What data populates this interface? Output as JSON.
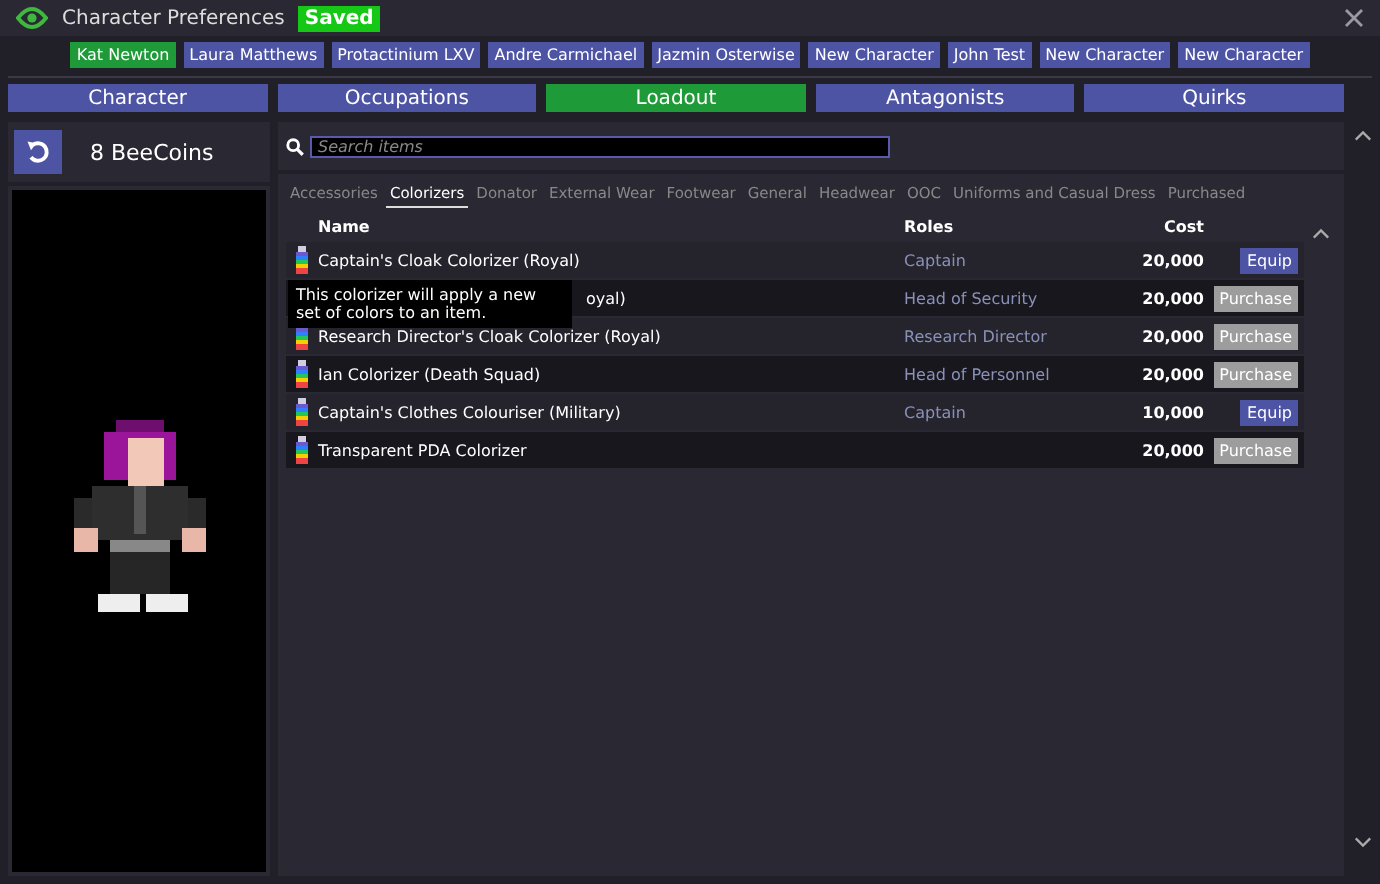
{
  "window": {
    "title": "Character Preferences",
    "status": "Saved"
  },
  "characters": [
    {
      "label": "Kat Newton",
      "selected": true
    },
    {
      "label": "Laura Matthews",
      "selected": false
    },
    {
      "label": "Protactinium LXV",
      "selected": false
    },
    {
      "label": "Andre Carmichael",
      "selected": false
    },
    {
      "label": "Jazmin Osterwise",
      "selected": false
    },
    {
      "label": "New Character",
      "selected": false
    },
    {
      "label": "John Test",
      "selected": false
    },
    {
      "label": "New Character",
      "selected": false
    },
    {
      "label": "New Character",
      "selected": false
    }
  ],
  "tabs": [
    {
      "label": "Character",
      "selected": false
    },
    {
      "label": "Occupations",
      "selected": false
    },
    {
      "label": "Loadout",
      "selected": true
    },
    {
      "label": "Antagonists",
      "selected": false
    },
    {
      "label": "Quirks",
      "selected": false
    }
  ],
  "wallet": {
    "balance": "8 BeeCoins"
  },
  "search": {
    "placeholder": "Search items"
  },
  "categories": [
    {
      "label": "Accessories",
      "selected": false
    },
    {
      "label": "Colorizers",
      "selected": true
    },
    {
      "label": "Donator",
      "selected": false
    },
    {
      "label": "External Wear",
      "selected": false
    },
    {
      "label": "Footwear",
      "selected": false
    },
    {
      "label": "General",
      "selected": false
    },
    {
      "label": "Headwear",
      "selected": false
    },
    {
      "label": "OOC",
      "selected": false
    },
    {
      "label": "Uniforms and Casual Dress",
      "selected": false
    },
    {
      "label": "Purchased",
      "selected": false
    }
  ],
  "table": {
    "columns": [
      "Name",
      "Roles",
      "Cost"
    ],
    "rows": [
      {
        "name": "Captain's Cloak Colorizer (Royal)",
        "roles": "Captain",
        "cost": "20,000",
        "action": "Equip",
        "kind": "equip",
        "covered": false
      },
      {
        "name": "oyal)",
        "roles": "Head of Security",
        "cost": "20,000",
        "action": "Purchase",
        "kind": "purchase",
        "covered": true
      },
      {
        "name": "Research Director's Cloak Colorizer (Royal)",
        "roles": "Research Director",
        "cost": "20,000",
        "action": "Purchase",
        "kind": "purchase",
        "covered": false
      },
      {
        "name": "Ian Colorizer (Death Squad)",
        "roles": "Head of Personnel",
        "cost": "20,000",
        "action": "Purchase",
        "kind": "purchase",
        "covered": false
      },
      {
        "name": "Captain's Clothes Colouriser (Military)",
        "roles": "Captain",
        "cost": "10,000",
        "action": "Equip",
        "kind": "equip",
        "covered": false
      },
      {
        "name": "Transparent PDA Colorizer",
        "cost": "20,000",
        "action": "Purchase",
        "kind": "purchase",
        "covered": false
      }
    ]
  },
  "tooltip": {
    "text": "This colorizer will apply a new set of colors to an item."
  }
}
